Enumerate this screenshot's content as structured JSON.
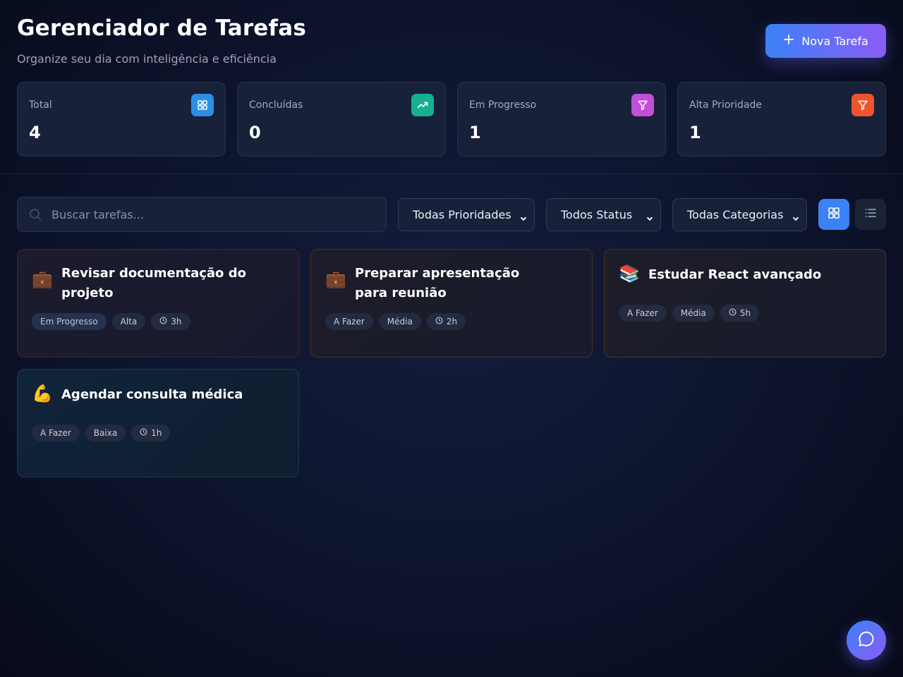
{
  "header": {
    "title": "Gerenciador de Tarefas",
    "subtitle": "Organize seu dia com inteligência e eficiência",
    "new_task_label": "Nova Tarefa"
  },
  "stats": [
    {
      "label": "Total",
      "value": "4",
      "icon": "grid-icon",
      "color": "#2b8fe6"
    },
    {
      "label": "Concluídas",
      "value": "0",
      "icon": "trending-up-icon",
      "color": "#16b08e"
    },
    {
      "label": "Em Progresso",
      "value": "1",
      "icon": "filter-icon",
      "color": "#c14fd8"
    },
    {
      "label": "Alta Prioridade",
      "value": "1",
      "icon": "filter-icon",
      "color": "#f0542c"
    }
  ],
  "filters": {
    "search_placeholder": "Buscar tarefas...",
    "priority": "Todas Prioridades",
    "status": "Todos Status",
    "category": "Todas Categorias"
  },
  "tasks": [
    {
      "emoji": "💼",
      "title": "Revisar documentação do projeto",
      "status": "Em Progresso",
      "priority": "Alta",
      "time": "3h"
    },
    {
      "emoji": "💼",
      "title": "Preparar apresentação para reunião",
      "status": "A Fazer",
      "priority": "Média",
      "time": "2h"
    },
    {
      "emoji": "📚",
      "title": "Estudar React avançado",
      "status": "A Fazer",
      "priority": "Média",
      "time": "5h"
    },
    {
      "emoji": "💪",
      "title": "Agendar consulta médica",
      "status": "A Fazer",
      "priority": "Baixa",
      "time": "1h"
    }
  ],
  "colors": {
    "accent_start": "#3b82f6",
    "accent_end": "#8b5cf6",
    "priority_high": "#ef4444",
    "priority_medium": "#f97316",
    "priority_low": "#14b8a6"
  }
}
